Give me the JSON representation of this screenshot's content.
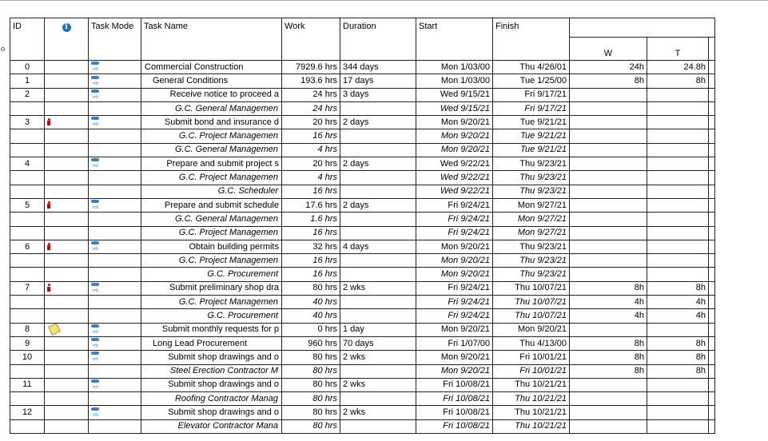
{
  "columns": {
    "id": "ID",
    "indicators_icon": "info-icon",
    "task_mode": "Task Mode",
    "task_name": "Task Name",
    "work": "Work",
    "duration": "Duration",
    "start": "Start",
    "finish": "Finish",
    "timescale_top": "",
    "day_w": "W",
    "day_t": "T"
  },
  "rows": [
    {
      "id": "0",
      "indicator": "",
      "mode": "auto",
      "name": "Commercial Construction",
      "level": 0,
      "work": "7929.6 hrs",
      "duration": "344 days",
      "start": "Mon 1/03/00",
      "finish": "Thu 4/26/01",
      "w": "24h",
      "t": "24.8h"
    },
    {
      "id": "1",
      "indicator": "",
      "mode": "auto",
      "name": "General Conditions",
      "level": 1,
      "work": "193.6 hrs",
      "duration": "17 days",
      "start": "Mon 1/03/00",
      "finish": "Tue 1/25/00",
      "w": "8h",
      "t": "8h"
    },
    {
      "id": "2",
      "indicator": "",
      "mode": "auto",
      "name": "Receive notice to proceed a",
      "level": 2,
      "work": "24 hrs",
      "duration": "3 days",
      "start": "Wed 9/15/21",
      "finish": "Fri 9/17/21",
      "w": "",
      "t": ""
    },
    {
      "id": "",
      "indicator": "",
      "mode": "",
      "name": "G.C. General Managemen",
      "level": "res",
      "work": "24 hrs",
      "duration": "",
      "start": "Wed 9/15/21",
      "finish": "Fri 9/17/21",
      "w": "",
      "t": ""
    },
    {
      "id": "3",
      "indicator": "person",
      "mode": "auto",
      "name": "Submit bond and insurance d",
      "level": 2,
      "work": "20 hrs",
      "duration": "2 days",
      "start": "Mon 9/20/21",
      "finish": "Tue 9/21/21",
      "w": "",
      "t": ""
    },
    {
      "id": "",
      "indicator": "",
      "mode": "",
      "name": "G.C. Project Managemen",
      "level": "res",
      "work": "16 hrs",
      "duration": "",
      "start": "Mon 9/20/21",
      "finish": "Tue 9/21/21",
      "w": "",
      "t": ""
    },
    {
      "id": "",
      "indicator": "",
      "mode": "",
      "name": "G.C. General Managemen",
      "level": "res",
      "work": "4 hrs",
      "duration": "",
      "start": "Mon 9/20/21",
      "finish": "Tue 9/21/21",
      "w": "",
      "t": ""
    },
    {
      "id": "4",
      "indicator": "",
      "mode": "auto",
      "name": "Prepare and submit project s",
      "level": 2,
      "work": "20 hrs",
      "duration": "2 days",
      "start": "Wed 9/22/21",
      "finish": "Thu 9/23/21",
      "w": "",
      "t": ""
    },
    {
      "id": "",
      "indicator": "",
      "mode": "",
      "name": "G.C. Project Managemen",
      "level": "res",
      "work": "4 hrs",
      "duration": "",
      "start": "Wed 9/22/21",
      "finish": "Thu 9/23/21",
      "w": "",
      "t": ""
    },
    {
      "id": "",
      "indicator": "",
      "mode": "",
      "name": "G.C. Scheduler",
      "level": "res",
      "work": "16 hrs",
      "duration": "",
      "start": "Wed 9/22/21",
      "finish": "Thu 9/23/21",
      "w": "",
      "t": ""
    },
    {
      "id": "5",
      "indicator": "person",
      "mode": "auto",
      "name": "Prepare and submit schedule",
      "level": 2,
      "work": "17.6 hrs",
      "duration": "2 days",
      "start": "Fri 9/24/21",
      "finish": "Mon 9/27/21",
      "w": "",
      "t": ""
    },
    {
      "id": "",
      "indicator": "",
      "mode": "",
      "name": "G.C. General Managemen",
      "level": "res",
      "work": "1.6 hrs",
      "duration": "",
      "start": "Fri 9/24/21",
      "finish": "Mon 9/27/21",
      "w": "",
      "t": ""
    },
    {
      "id": "",
      "indicator": "",
      "mode": "",
      "name": "G.C. Project Managemen",
      "level": "res",
      "work": "16 hrs",
      "duration": "",
      "start": "Fri 9/24/21",
      "finish": "Mon 9/27/21",
      "w": "",
      "t": ""
    },
    {
      "id": "6",
      "indicator": "person",
      "mode": "auto",
      "name": "Obtain building permits",
      "level": 2,
      "work": "32 hrs",
      "duration": "4 days",
      "start": "Mon 9/20/21",
      "finish": "Thu 9/23/21",
      "w": "",
      "t": ""
    },
    {
      "id": "",
      "indicator": "",
      "mode": "",
      "name": "G.C. Project Managemen",
      "level": "res",
      "work": "16 hrs",
      "duration": "",
      "start": "Mon 9/20/21",
      "finish": "Thu 9/23/21",
      "w": "",
      "t": ""
    },
    {
      "id": "",
      "indicator": "",
      "mode": "",
      "name": "G.C. Procurement",
      "level": "res",
      "work": "16 hrs",
      "duration": "",
      "start": "Mon 9/20/21",
      "finish": "Thu 9/23/21",
      "w": "",
      "t": ""
    },
    {
      "id": "7",
      "indicator": "person",
      "mode": "auto",
      "name": "Submit preliminary shop dra",
      "level": 2,
      "work": "80 hrs",
      "duration": "2 wks",
      "start": "Fri 9/24/21",
      "finish": "Thu 10/07/21",
      "w": "8h",
      "t": "8h"
    },
    {
      "id": "",
      "indicator": "",
      "mode": "",
      "name": "G.C. Project Managemen",
      "level": "res",
      "work": "40 hrs",
      "duration": "",
      "start": "Fri 9/24/21",
      "finish": "Thu 10/07/21",
      "w": "4h",
      "t": "4h"
    },
    {
      "id": "",
      "indicator": "",
      "mode": "",
      "name": "G.C. Procurement",
      "level": "res",
      "work": "40 hrs",
      "duration": "",
      "start": "Fri 9/24/21",
      "finish": "Thu 10/07/21",
      "w": "4h",
      "t": "4h"
    },
    {
      "id": "8",
      "indicator": "note",
      "mode": "auto",
      "name": "Submit monthly requests for p",
      "level": 2,
      "work": "0 hrs",
      "duration": "1 day",
      "start": "Mon 9/20/21",
      "finish": "Mon 9/20/21",
      "w": "",
      "t": ""
    },
    {
      "id": "9",
      "indicator": "",
      "mode": "auto",
      "name": "Long Lead Procurement",
      "level": 1,
      "work": "960 hrs",
      "duration": "70 days",
      "start": "Fri 1/07/00",
      "finish": "Thu 4/13/00",
      "w": "8h",
      "t": "8h"
    },
    {
      "id": "10",
      "indicator": "",
      "mode": "auto",
      "name": "Submit shop drawings and o",
      "level": 2,
      "work": "80 hrs",
      "duration": "2 wks",
      "start": "Mon 9/20/21",
      "finish": "Fri 10/01/21",
      "w": "8h",
      "t": "8h"
    },
    {
      "id": "",
      "indicator": "",
      "mode": "",
      "name": "Steel Erection Contractor M",
      "level": "res",
      "work": "80 hrs",
      "duration": "",
      "start": "Mon 9/20/21",
      "finish": "Fri 10/01/21",
      "w": "8h",
      "t": "8h"
    },
    {
      "id": "11",
      "indicator": "",
      "mode": "auto",
      "name": "Submit shop drawings and o",
      "level": 2,
      "work": "80 hrs",
      "duration": "2 wks",
      "start": "Fri 10/08/21",
      "finish": "Thu 10/21/21",
      "w": "",
      "t": ""
    },
    {
      "id": "",
      "indicator": "",
      "mode": "",
      "name": "Roofing Contractor Manag",
      "level": "res",
      "work": "80 hrs",
      "duration": "",
      "start": "Fri 10/08/21",
      "finish": "Thu 10/21/21",
      "w": "",
      "t": ""
    },
    {
      "id": "12",
      "indicator": "",
      "mode": "auto",
      "name": "Submit shop drawings and o",
      "level": 2,
      "work": "80 hrs",
      "duration": "2 wks",
      "start": "Fri 10/08/21",
      "finish": "Thu 10/21/21",
      "w": "",
      "t": ""
    },
    {
      "id": "",
      "indicator": "",
      "mode": "",
      "name": "Elevator Contractor Mana",
      "level": "res",
      "work": "80 hrs",
      "duration": "",
      "start": "Fri 10/08/21",
      "finish": "Thu 10/21/21",
      "w": "",
      "t": ""
    }
  ]
}
